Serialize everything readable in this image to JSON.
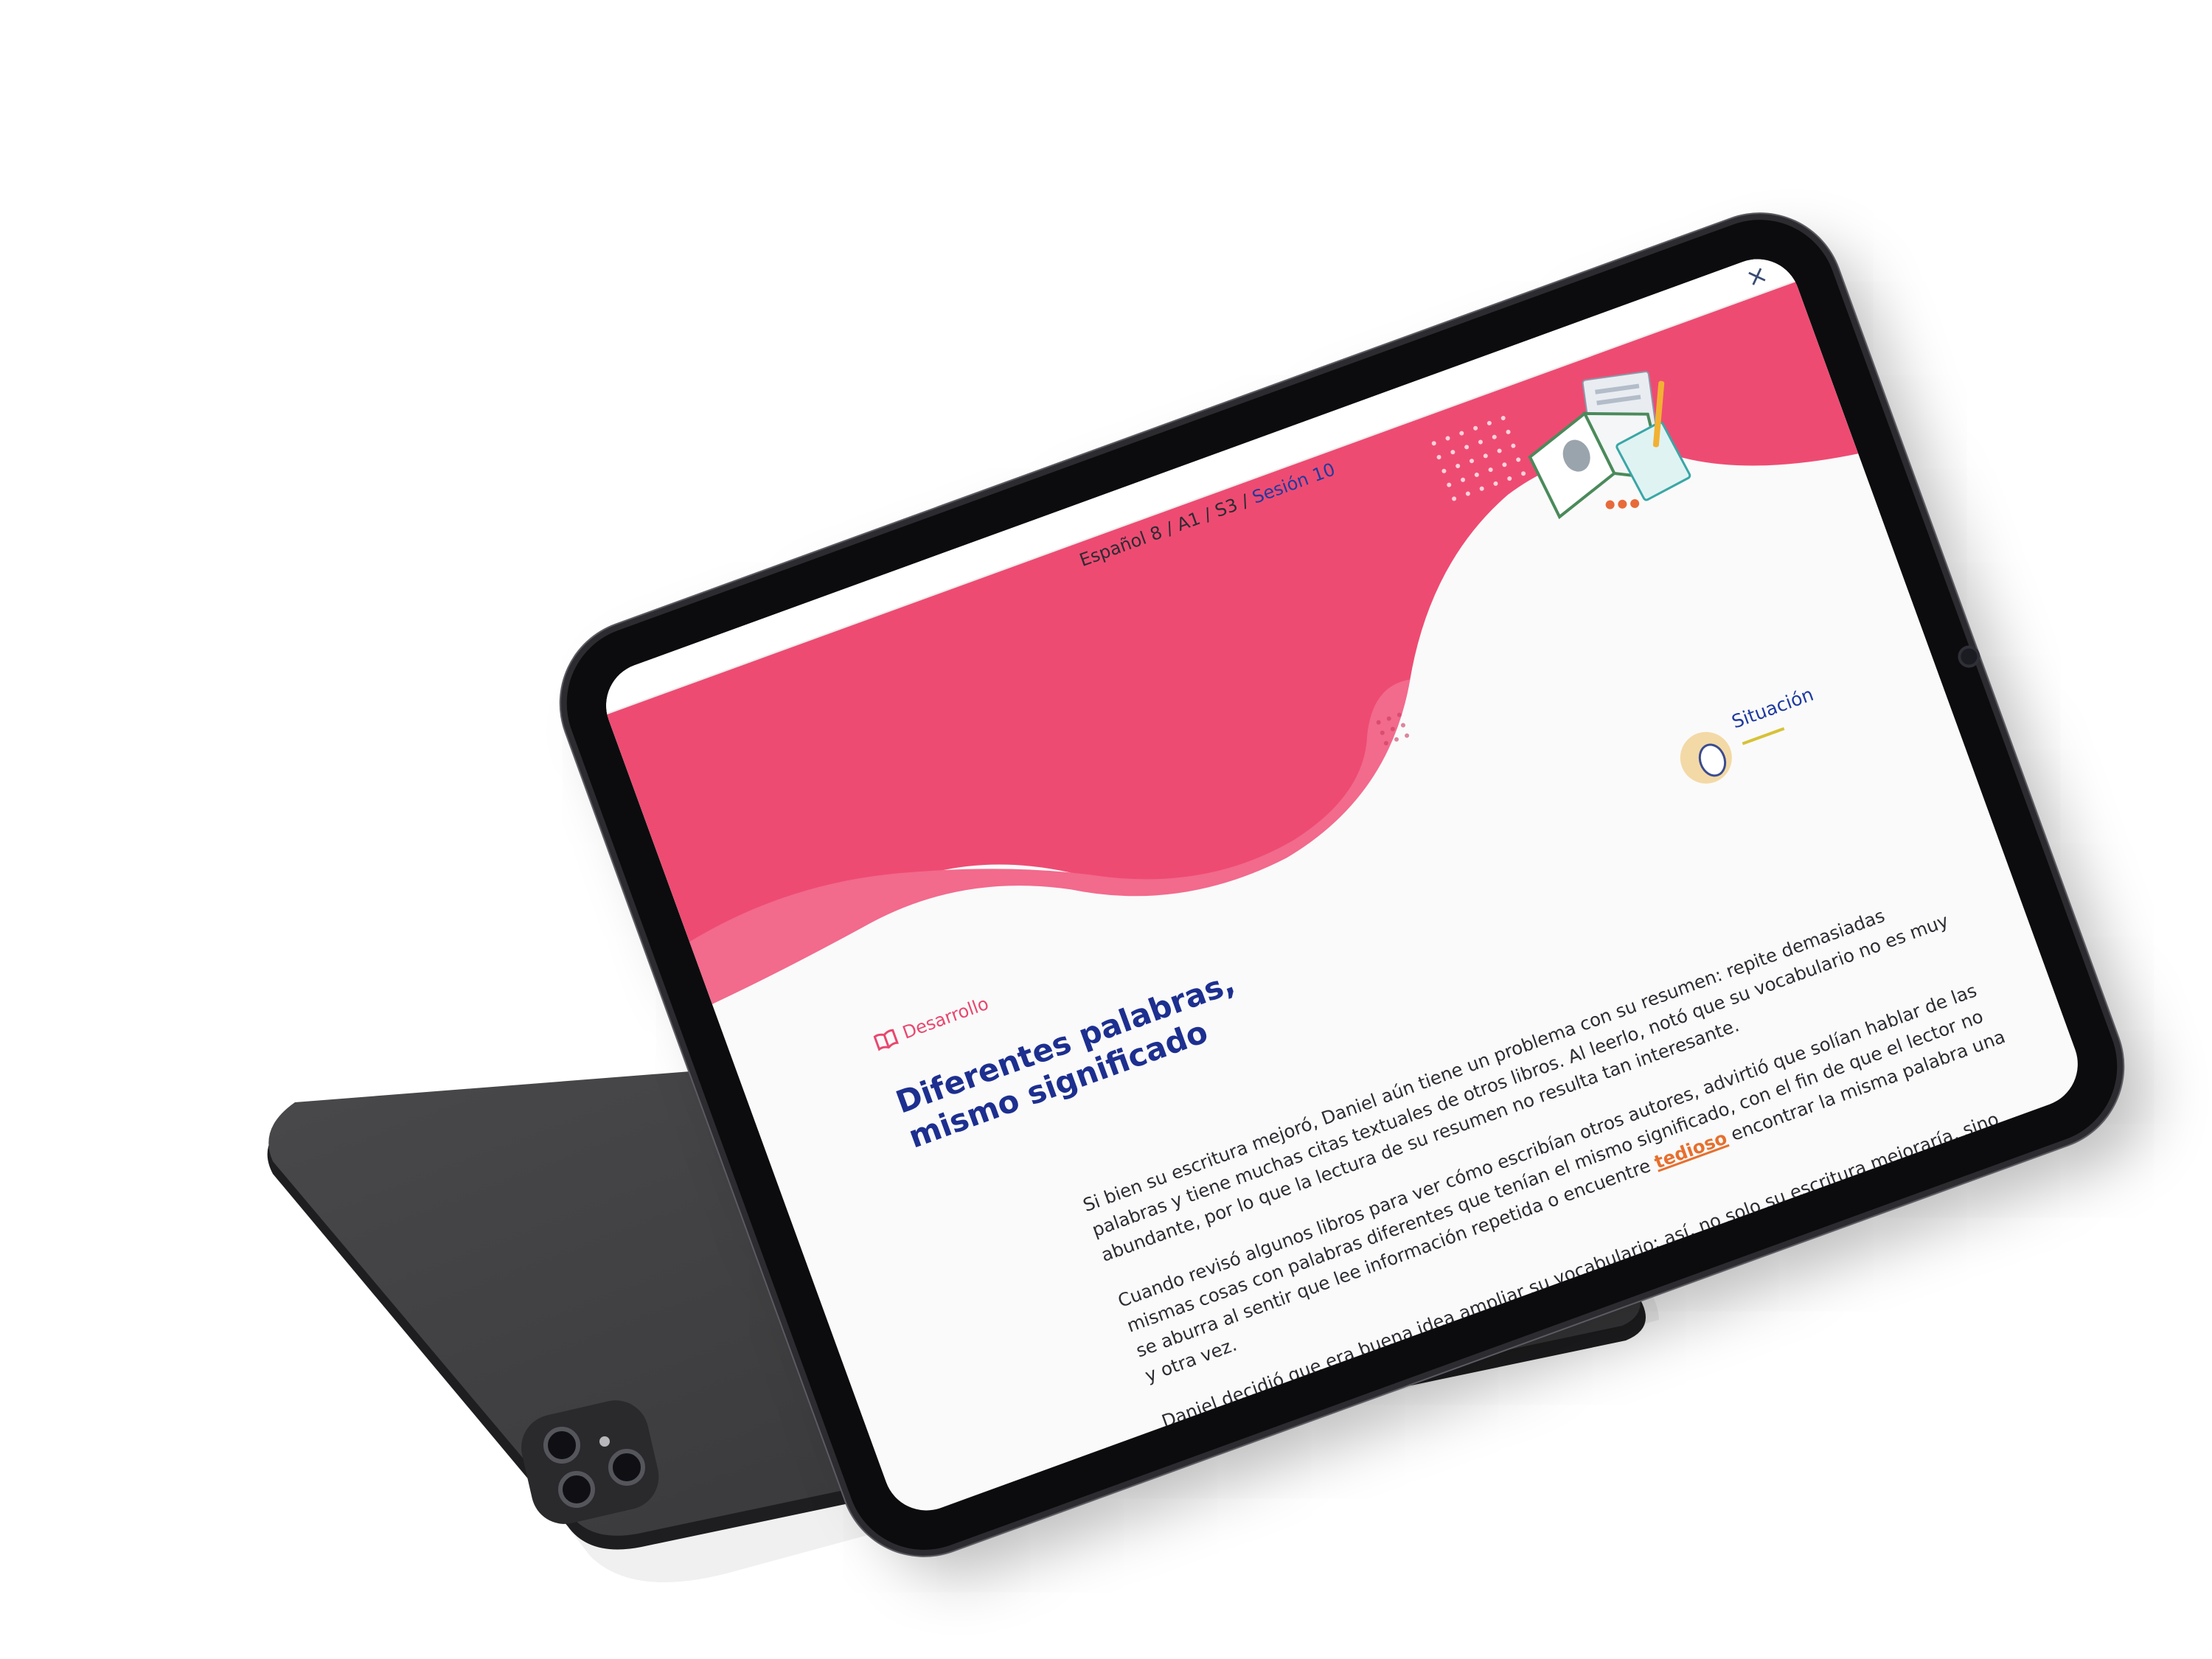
{
  "breadcrumb": {
    "path": "Español 8 / A1 / S3 / ",
    "current": "Sesión 10"
  },
  "close_icon_glyph": "×",
  "section": {
    "icon": "open-book-icon",
    "label": "Desarrollo"
  },
  "title": {
    "line1": "Diferentes palabras,",
    "line2": "mismo significado"
  },
  "situacion": {
    "icon": "lightbulb-thinking-icon",
    "label": "Situación"
  },
  "illustration": "books-and-notes-illustration",
  "paragraphs": {
    "p1": "Si bien su escritura mejoró, Daniel aún tiene un problema con su resumen: repite demasiadas palabras y tiene muchas citas textuales de otros libros. Al leerlo, notó que su vocabulario no es muy abundante, por lo que la lectura de su resumen no resulta tan interesante.",
    "p2_before": "Cuando revisó algunos libros para ver cómo escribían otros autores, advirtió que solían hablar de las mismas cosas con palabras diferentes que tenían el mismo significado, con el fin de que el lector no se aburra al sentir que lee información repetida o encuentre ",
    "p2_highlight": "tedioso",
    "p2_after": " encontrar la misma palabra una y otra vez.",
    "p3": "Daniel decidió que era buena idea ampliar su vocabulario; así, no solo su escritura mejoraría, sino también sus habilidades para hablar."
  },
  "colors": {
    "accent_pink": "#EE4B72",
    "title_blue": "#1D2F8F",
    "highlight_orange": "#E76F2E",
    "device_dark": "#3D3D3D"
  }
}
